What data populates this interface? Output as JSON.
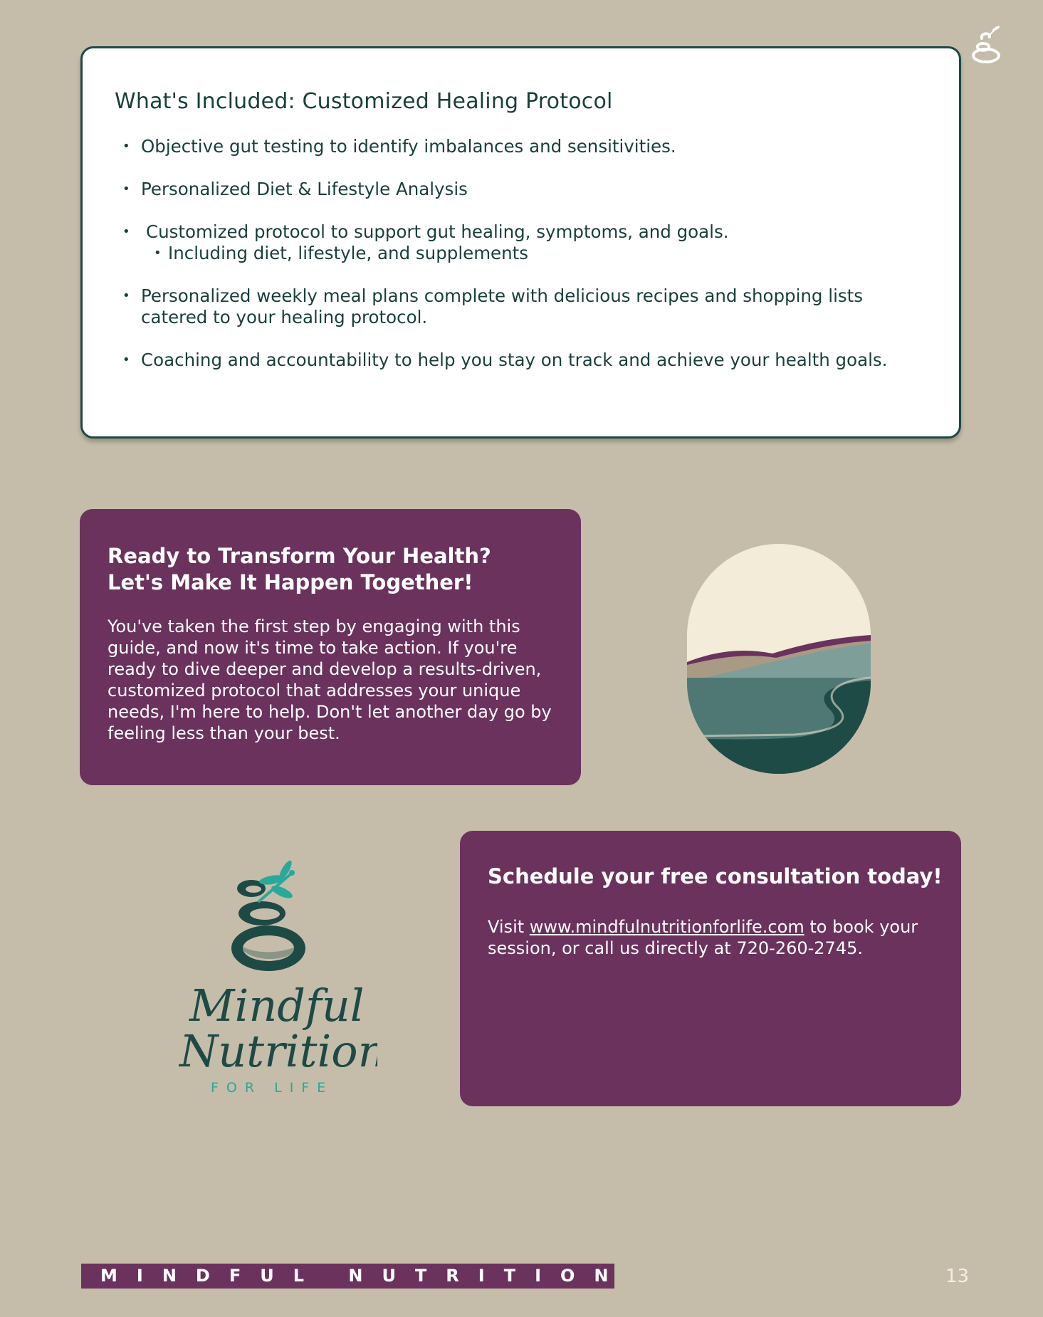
{
  "included": {
    "title": "What's Included: Customized Healing Protocol",
    "items": [
      "Objective gut testing to identify imbalances and sensitivities.",
      "Personalized Diet & Lifestyle Analysis",
      "Customized protocol to support gut healing, symptoms, and goals.",
      "Personalized weekly meal plans complete with delicious recipes and shopping lists catered to your healing protocol.",
      "Coaching and accountability to help you stay on track and achieve your health goals."
    ],
    "subitems": [
      "Including diet, lifestyle, and supplements"
    ]
  },
  "transform": {
    "heading_line1": "Ready to Transform Your Health?",
    "heading_line2": "Let's Make It Happen Together!",
    "body": "You've taken the first step by engaging with this guide, and now it's time to take action. If you're ready to dive deeper and develop a results-driven, customized protocol that addresses your unique needs, I'm here to help. Don't let another day go by feeling less than your best."
  },
  "schedule": {
    "heading": "Schedule your free consultation today!",
    "body_prefix": "Visit",
    "link_text": "www.mindfulnutritionforlife.com",
    "body_suffix": "to book your session, or call us directly at 720-260-2745."
  },
  "brand": {
    "line1": "Mindful",
    "line2": "Nutrition",
    "tagline": "FOR LIFE"
  },
  "footer": {
    "text": "MINDFUL NUTRITION",
    "page_number": "13"
  },
  "colors": {
    "background": "#c5bdaa",
    "plum": "#6a325d",
    "dark_teal": "#1d4a45",
    "accent_teal": "#2aa89a"
  }
}
